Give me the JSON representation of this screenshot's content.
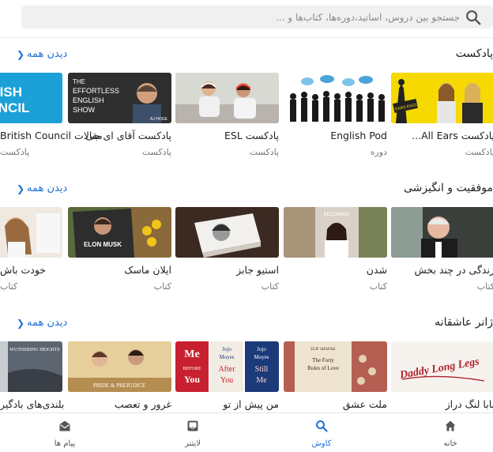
{
  "search": {
    "placeholder": "جستجو بین دروس، اساتید،دوره‌ها، کتاب‌ها و ..."
  },
  "sections": [
    {
      "title": "پادکست",
      "see_all": "دیدن همه",
      "items": [
        {
          "title": "پادکست All Ears...",
          "type": "پادکست",
          "thumb_text": "ALL EARS ENGLISH"
        },
        {
          "title": "English Pod",
          "type": "دوره",
          "thumb_text": ""
        },
        {
          "title": "پادکست ESL",
          "type": "پادکست",
          "thumb_text": ""
        },
        {
          "title": "پادکست آقای ای جی",
          "type": "پادکست",
          "thumb_text": "THE EFFORTLESS ENGLISH SHOW"
        },
        {
          "title": "مقالات British Council",
          "type": "پادکست",
          "thumb_text": "BRITISH COUNCIL"
        }
      ]
    },
    {
      "title": "موفقیت و انگیزشی",
      "see_all": "دیدن همه",
      "items": [
        {
          "title": "زندگی در چند بخش",
          "type": "کتاب",
          "thumb_text": ""
        },
        {
          "title": "شدن",
          "type": "کتاب",
          "thumb_text": "BECOMING"
        },
        {
          "title": "استیو جابز",
          "type": "کتاب",
          "thumb_text": ""
        },
        {
          "title": "ایلان ماسک",
          "type": "کتاب",
          "thumb_text": "ELON MUSK"
        },
        {
          "title": "خودت باش",
          "type": "کتاب",
          "thumb_text": ""
        }
      ]
    },
    {
      "title": "ژانر عاشقانه",
      "see_all": "دیدن همه",
      "items": [
        {
          "title": "بابا لنگ دراز",
          "type": "",
          "thumb_text": "Daddy Long Legs"
        },
        {
          "title": "ملت عشق",
          "type": "",
          "thumb_text": "The Forty Rules of Love"
        },
        {
          "title": "من پیش از تو",
          "type": "",
          "thumb_text": "Me Before You"
        },
        {
          "title": "غرور و تعصب",
          "type": "",
          "thumb_text": "PRIDE & PREJUDICE"
        },
        {
          "title": "بلندی‌های بادگیر",
          "type": "",
          "thumb_text": "WUTHERING HEIGHTS"
        }
      ]
    }
  ],
  "tabs": [
    {
      "label": "خانه",
      "icon": "home-icon",
      "active": false
    },
    {
      "label": "کاوش",
      "icon": "search-icon",
      "active": true
    },
    {
      "label": "لایتنر",
      "icon": "inbox-icon",
      "active": false
    },
    {
      "label": "پیام ها",
      "icon": "mail-icon",
      "active": false
    }
  ],
  "colors": {
    "accent": "#1e6fd9",
    "text": "#222222",
    "muted": "#777777"
  }
}
